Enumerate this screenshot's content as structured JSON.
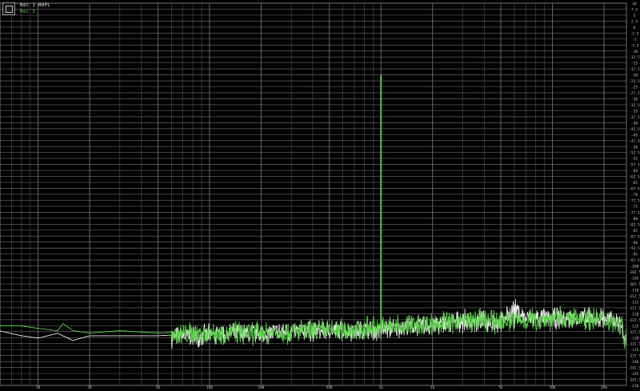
{
  "legend": {
    "series": [
      {
        "label": "Rec 1 HDPL",
        "color": "#e8e8e8"
      },
      {
        "label": "Rec 3",
        "color": "#5cd64a"
      }
    ]
  },
  "colors": {
    "background": "#000000",
    "grid": "#7a7a7a",
    "noise_white": "#e8e8e8",
    "noise_green": "#5cd64a"
  },
  "chart_data": {
    "type": "line",
    "title": "",
    "xlabel": "",
    "ylabel": "",
    "xscale": "log",
    "xlim": [
      6,
      27000
    ],
    "ylim": [
      -150,
      10
    ],
    "x_tick_labels": [
      "10",
      "20",
      "50",
      "100",
      "200",
      "500",
      "1k",
      "2k",
      "5k",
      "10k",
      "20k"
    ],
    "y_ticks_every_dB": 2.5,
    "grid": true,
    "legend_position": "top-left",
    "series": [
      {
        "name": "Rec 1 HDPL",
        "color": "#e8e8e8",
        "points": [
          [
            6,
            -128
          ],
          [
            8,
            -130
          ],
          [
            10,
            -131
          ],
          [
            13,
            -129
          ],
          [
            16,
            -132
          ],
          [
            20,
            -130
          ],
          [
            30,
            -130
          ],
          [
            50,
            -130
          ],
          [
            100,
            -129
          ],
          [
            200,
            -128
          ],
          [
            500,
            -127
          ],
          [
            1000,
            -127
          ],
          [
            1500,
            -125
          ],
          [
            2000,
            -125
          ],
          [
            3000,
            -123
          ],
          [
            5000,
            -124
          ],
          [
            6000,
            -118
          ],
          [
            7000,
            -122
          ],
          [
            10000,
            -122
          ],
          [
            20000,
            -122
          ],
          [
            25000,
            -124
          ],
          [
            26500,
            -131
          ]
        ]
      },
      {
        "name": "Rec 3",
        "color": "#5cd64a",
        "points": [
          [
            6,
            -126
          ],
          [
            8,
            -126
          ],
          [
            10,
            -127
          ],
          [
            13,
            -128
          ],
          [
            14,
            -125
          ],
          [
            16,
            -128
          ],
          [
            20,
            -129
          ],
          [
            30,
            -128
          ],
          [
            50,
            -129
          ],
          [
            100,
            -128
          ],
          [
            200,
            -128
          ],
          [
            500,
            -127
          ],
          [
            1000,
            -20
          ],
          [
            1500,
            -125
          ],
          [
            2000,
            -124
          ],
          [
            3000,
            -123
          ],
          [
            5000,
            -123
          ],
          [
            10000,
            -122
          ],
          [
            20000,
            -122
          ],
          [
            25000,
            -124
          ],
          [
            26500,
            -130
          ]
        ]
      }
    ]
  }
}
